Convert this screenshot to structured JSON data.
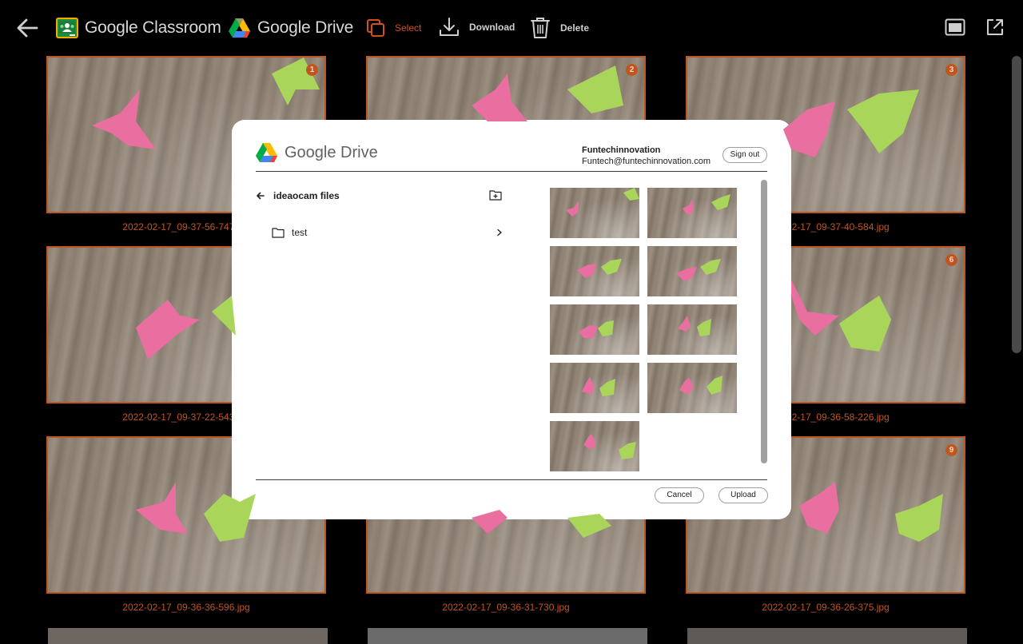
{
  "toolbar": {
    "classroom_label": "Google Classroom",
    "drive_label": "Google Drive",
    "select_label": "Select",
    "download_label": "Download",
    "delete_label": "Delete"
  },
  "colors": {
    "accent": "#c0561f",
    "background": "#000000",
    "dialog": "#ffffff"
  },
  "gallery": {
    "tiles": [
      {
        "badge": "1",
        "caption": "2022-02-17_09-37-56-747.jpg"
      },
      {
        "badge": "2",
        "caption": ""
      },
      {
        "badge": "3",
        "caption": "2022-02-17_09-37-40-584.jpg"
      },
      {
        "badge": "",
        "caption": "2022-02-17_09-37-22-543.jpg"
      },
      {
        "badge": "",
        "caption": ""
      },
      {
        "badge": "6",
        "caption": "2022-02-17_09-36-58-226.jpg"
      },
      {
        "badge": "",
        "caption": "2022-02-17_09-36-36-596.jpg"
      },
      {
        "badge": "",
        "caption": "2022-02-17_09-36-31-730.jpg"
      },
      {
        "badge": "9",
        "caption": "2022-02-17_09-36-26-375.jpg"
      }
    ]
  },
  "dialog": {
    "brand": "Google Drive",
    "account_name": "Funtechinnovation",
    "account_email": "Funtech@funtechinnovation.com",
    "sign_out": "Sign out",
    "breadcrumb": "ideaocam files",
    "folders": [
      {
        "name": "test"
      }
    ],
    "cancel": "Cancel",
    "upload": "Upload"
  }
}
